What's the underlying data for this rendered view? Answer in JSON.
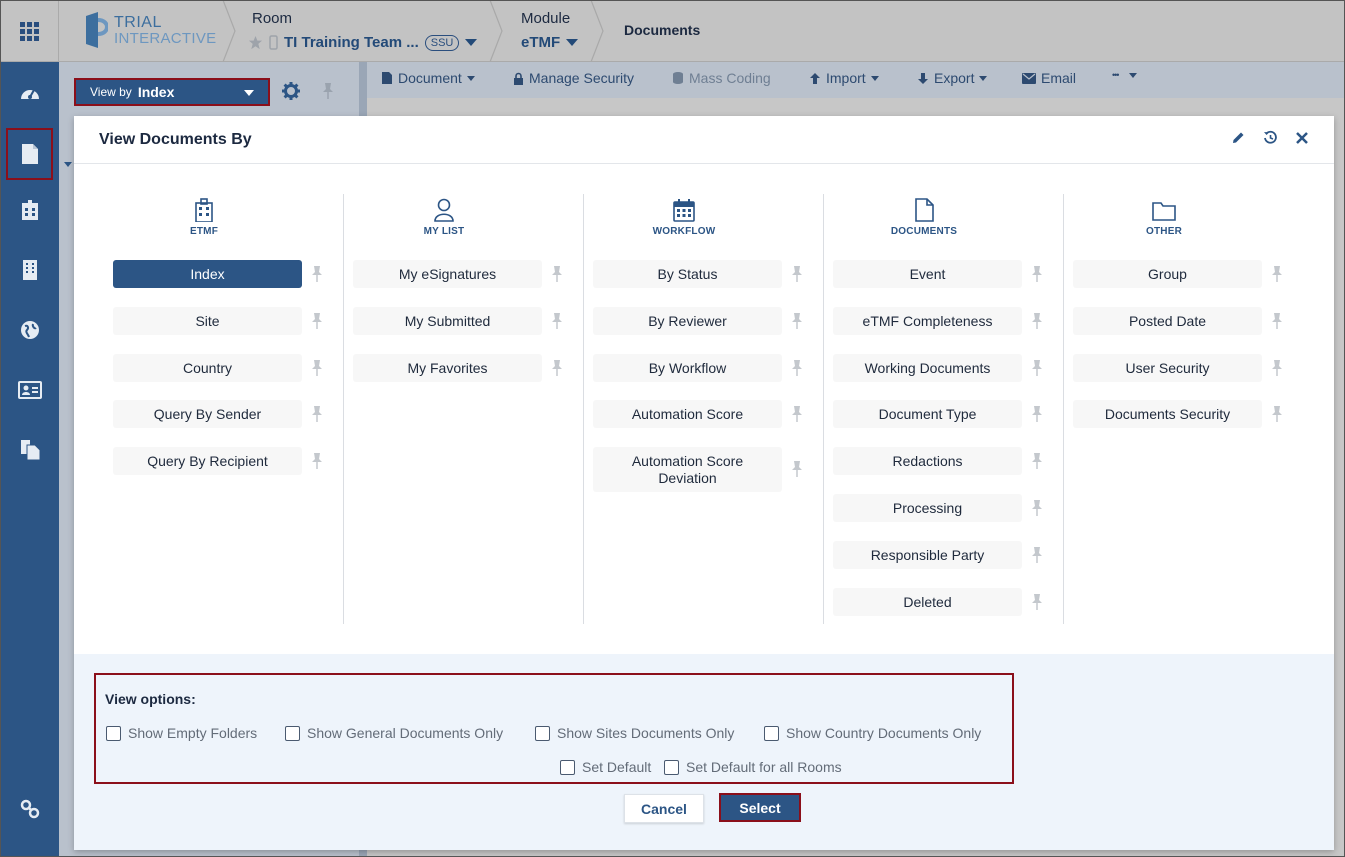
{
  "topbar": {
    "logo_line1": "TRIAL",
    "logo_line2": "INTERACTIVE",
    "room_label": "Room",
    "room_value": "TI Training Team ...",
    "room_badge": "SSU",
    "module_label": "Module",
    "module_value": "eTMF",
    "page_crumb": "Documents"
  },
  "view_by": {
    "prefix": "View by",
    "value": "Index"
  },
  "toolbar": {
    "document": "Document",
    "manage_security": "Manage Security",
    "mass_coding": "Mass Coding",
    "import": "Import",
    "export": "Export",
    "email": "Email",
    "more": "•••"
  },
  "modal": {
    "title": "View Documents By",
    "columns": [
      {
        "title": "ETMF",
        "icon": "building-icon",
        "items": [
          {
            "label": "Index",
            "selected": true
          },
          {
            "label": "Site"
          },
          {
            "label": "Country"
          },
          {
            "label": "Query By Sender"
          },
          {
            "label": "Query By Recipient"
          }
        ]
      },
      {
        "title": "MY LIST",
        "icon": "user-icon",
        "items": [
          {
            "label": "My eSignatures"
          },
          {
            "label": "My Submitted"
          },
          {
            "label": "My Favorites"
          }
        ]
      },
      {
        "title": "WORKFLOW",
        "icon": "calendar-icon",
        "items": [
          {
            "label": "By Status"
          },
          {
            "label": "By Reviewer"
          },
          {
            "label": "By Workflow"
          },
          {
            "label": "Automation Score"
          },
          {
            "label": "Automation Score Deviation"
          }
        ]
      },
      {
        "title": "DOCUMENTS",
        "icon": "file-icon",
        "items": [
          {
            "label": "Event"
          },
          {
            "label": "eTMF Completeness"
          },
          {
            "label": "Working Documents"
          },
          {
            "label": "Document Type"
          },
          {
            "label": "Redactions"
          },
          {
            "label": "Processing"
          },
          {
            "label": "Responsible Party"
          },
          {
            "label": "Deleted"
          }
        ]
      },
      {
        "title": "OTHER",
        "icon": "folder-icon",
        "items": [
          {
            "label": "Group"
          },
          {
            "label": "Posted Date"
          },
          {
            "label": "User Security"
          },
          {
            "label": "Documents Security"
          }
        ]
      }
    ],
    "view_options": {
      "title": "View options:",
      "checkboxes": [
        {
          "label": "Show Empty Folders",
          "checked": false
        },
        {
          "label": "Show General Documents Only",
          "checked": false
        },
        {
          "label": "Show Sites Documents Only",
          "checked": false
        },
        {
          "label": "Show Country Documents Only",
          "checked": false
        },
        {
          "label": "Set Default",
          "checked": false
        },
        {
          "label": "Set Default for all Rooms",
          "checked": false
        }
      ]
    },
    "cancel": "Cancel",
    "select": "Select"
  },
  "colors": {
    "primary": "#2c5585",
    "highlight": "#8b0f1a"
  }
}
